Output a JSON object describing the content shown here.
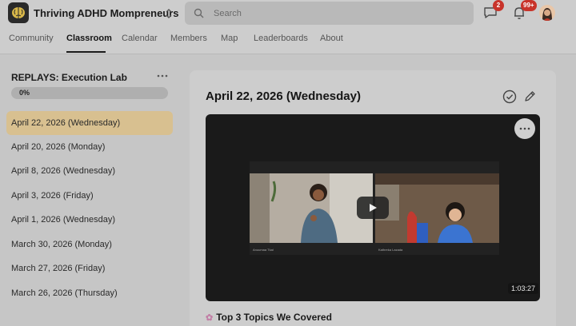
{
  "header": {
    "group_name": "Thriving ADHD Mompreneurs",
    "logo_icon": "brain-icon",
    "search": {
      "placeholder": "Search",
      "value": ""
    },
    "chat_badge": "2",
    "notification_badge": "99+",
    "badge_color": "#c8332a"
  },
  "nav": {
    "tabs": [
      {
        "label": "Community"
      },
      {
        "label": "Classroom",
        "active": true
      },
      {
        "label": "Calendar"
      },
      {
        "label": "Members"
      },
      {
        "label": "Map"
      },
      {
        "label": "Leaderboards"
      },
      {
        "label": "About"
      }
    ]
  },
  "sidebar": {
    "course_title": "REPLAYS: Execution Lab",
    "progress_label": "0%",
    "progress_value": 0,
    "lessons": [
      {
        "label": "April 22, 2026 (Wednesday)",
        "active": true
      },
      {
        "label": "April 20, 2026 (Monday)"
      },
      {
        "label": "April 8, 2026 (Wednesday)"
      },
      {
        "label": "April 3, 2026 (Friday)"
      },
      {
        "label": "April 1, 2026 (Wednesday)"
      },
      {
        "label": "March 30, 2026 (Monday)"
      },
      {
        "label": "March 27, 2026 (Friday)"
      },
      {
        "label": "March 26, 2026 (Thursday)"
      }
    ],
    "active_color": "#d8c090"
  },
  "content": {
    "title": "April 22, 2026 (Wednesday)",
    "video": {
      "duration": "1:03:27",
      "participant_left": "Anuumaa Tkal",
      "participant_right": "Kathreka Lazada"
    },
    "section_heading": "Top 3 Topics We Covered",
    "section_icon": "brain-icon"
  }
}
